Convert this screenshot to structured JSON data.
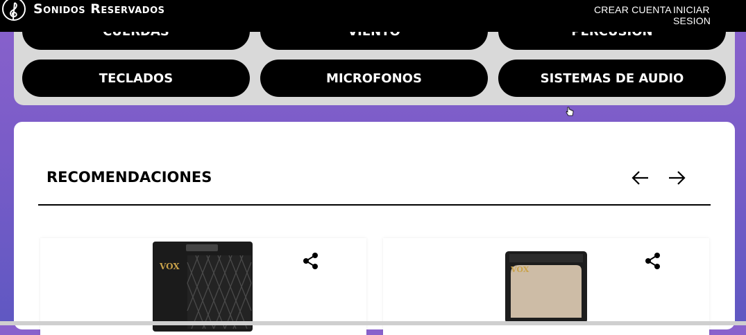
{
  "header": {
    "brand": "Sonidos Reservados",
    "nav": {
      "register": "CREAR CUENTA",
      "login": "INICIAR SESION"
    }
  },
  "categories": {
    "row1": [
      "CUERDAS",
      "VIENTO",
      "PERCUSION"
    ],
    "row2": [
      "TECLADOS",
      "MICROFONOS",
      "SISTEMAS DE AUDIO"
    ]
  },
  "recommendations": {
    "title": "RECOMENDACIONES",
    "products": [
      {
        "brand_logo": "VOX"
      },
      {
        "brand_logo": "VOX"
      }
    ]
  },
  "icons": {
    "logo": "treble-clef-icon",
    "prev": "arrow-left-icon",
    "next": "arrow-right-icon",
    "share": "share-icon"
  },
  "colors": {
    "background_top": "#8a62cc",
    "background_bottom": "#5f58c2",
    "panel": "#d9d9d9",
    "button": "#000000"
  }
}
